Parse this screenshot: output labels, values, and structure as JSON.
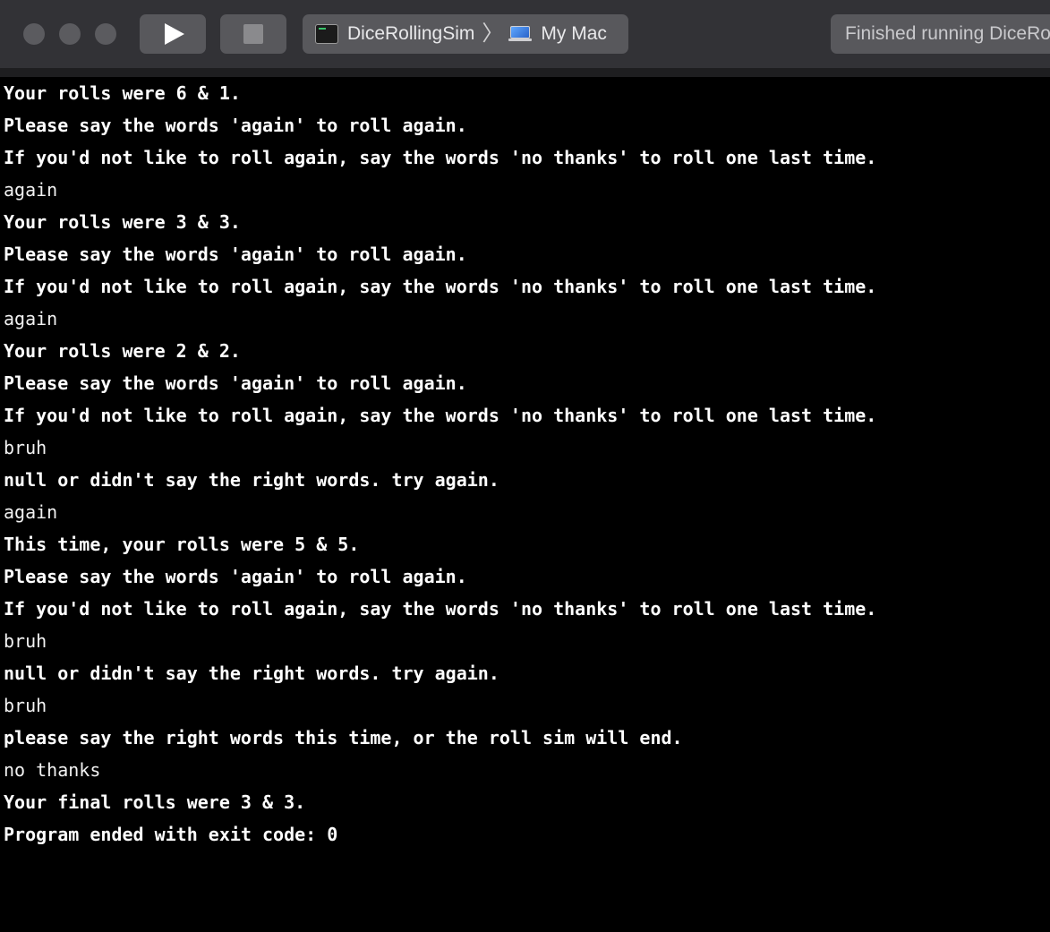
{
  "toolbar": {
    "scheme": "DiceRollingSim",
    "separator": "〉",
    "destination": "My Mac",
    "status": "Finished running DiceRollingSim",
    "icons": {
      "close": "traffic-light-close",
      "minimize": "traffic-light-minimize",
      "zoom": "traffic-light-zoom",
      "run": "play-icon",
      "stop": "stop-icon",
      "scheme_icon": "terminal-icon",
      "destination_icon": "laptop-icon"
    }
  },
  "console": {
    "lines": [
      {
        "text": "Your rolls were 6 & 1.",
        "kind": "output"
      },
      {
        "text": "Please say the words 'again' to roll again.",
        "kind": "output"
      },
      {
        "text": "If you'd not like to roll again, say the words 'no thanks' to roll one last time.",
        "kind": "output"
      },
      {
        "text": "again",
        "kind": "input"
      },
      {
        "text": "Your rolls were 3 & 3.",
        "kind": "output"
      },
      {
        "text": "Please say the words 'again' to roll again.",
        "kind": "output"
      },
      {
        "text": "If you'd not like to roll again, say the words 'no thanks' to roll one last time.",
        "kind": "output"
      },
      {
        "text": "again",
        "kind": "input"
      },
      {
        "text": "Your rolls were 2 & 2.",
        "kind": "output"
      },
      {
        "text": "Please say the words 'again' to roll again.",
        "kind": "output"
      },
      {
        "text": "If you'd not like to roll again, say the words 'no thanks' to roll one last time.",
        "kind": "output"
      },
      {
        "text": "bruh",
        "kind": "input"
      },
      {
        "text": "null or didn't say the right words. try again.",
        "kind": "output"
      },
      {
        "text": "again",
        "kind": "input"
      },
      {
        "text": "This time, your rolls were 5 & 5.",
        "kind": "output"
      },
      {
        "text": "Please say the words 'again' to roll again.",
        "kind": "output"
      },
      {
        "text": "If you'd not like to roll again, say the words 'no thanks' to roll one last time.",
        "kind": "output"
      },
      {
        "text": "bruh",
        "kind": "input"
      },
      {
        "text": "null or didn't say the right words. try again.",
        "kind": "output"
      },
      {
        "text": "bruh",
        "kind": "input"
      },
      {
        "text": "please say the right words this time, or the roll sim will end.",
        "kind": "output"
      },
      {
        "text": "no thanks",
        "kind": "input"
      },
      {
        "text": "Your final rolls were 3 & 3.",
        "kind": "output"
      },
      {
        "text": "Program ended with exit code: 0",
        "kind": "output"
      }
    ]
  }
}
